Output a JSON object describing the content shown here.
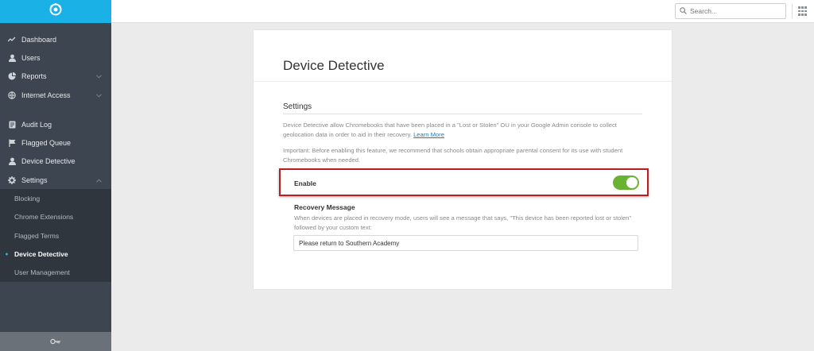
{
  "sidebar": {
    "logo_icon": "brand-logo-icon",
    "accent_color": "#1ab1e6",
    "items": [
      {
        "label": "Dashboard",
        "icon": "chart-line-icon"
      },
      {
        "label": "Users",
        "icon": "user-icon"
      },
      {
        "label": "Reports",
        "icon": "pie-chart-icon",
        "expandable": true
      },
      {
        "label": "Internet Access",
        "icon": "globe-icon",
        "expandable": true
      }
    ],
    "items2": [
      {
        "label": "Audit Log",
        "icon": "document-icon"
      },
      {
        "label": "Flagged Queue",
        "icon": "flag-icon"
      },
      {
        "label": "Device Detective",
        "icon": "user-icon"
      },
      {
        "label": "Settings",
        "icon": "gear-icon",
        "expanded": true
      }
    ],
    "settings_sub": [
      {
        "label": "Blocking"
      },
      {
        "label": "Chrome Extensions"
      },
      {
        "label": "Flagged Terms"
      },
      {
        "label": "Device Detective",
        "active": true
      },
      {
        "label": "User Management"
      }
    ],
    "footer_icon": "key-icon"
  },
  "topbar": {
    "search_placeholder": "Search...",
    "apps_icon": "grid-icon"
  },
  "card": {
    "title": "Device Detective",
    "section_title": "Settings",
    "desc_text": "Device Detective allow Chromebooks that have been placed in a \"Lost or Stolen\" OU in your Google Admin console to collect geolocation data in order to aid in their recovery.",
    "learn_more": "Learn More",
    "important_text": "Important: Before enabling this feature, we recommend that schools obtain appropriate parental consent for its use with student Chromebooks when needed.",
    "enable_label": "Enable",
    "enable_on": true,
    "toggle_color": "#6ab232",
    "highlight_color": "#b81f25",
    "recovery_title": "Recovery Message",
    "recovery_desc": "When devices are placed in recovery mode, users will see a message that says, \"This device has been reported lost or stolen\" followed by your custom text:",
    "recovery_value": "Please return to Southern Academy"
  }
}
